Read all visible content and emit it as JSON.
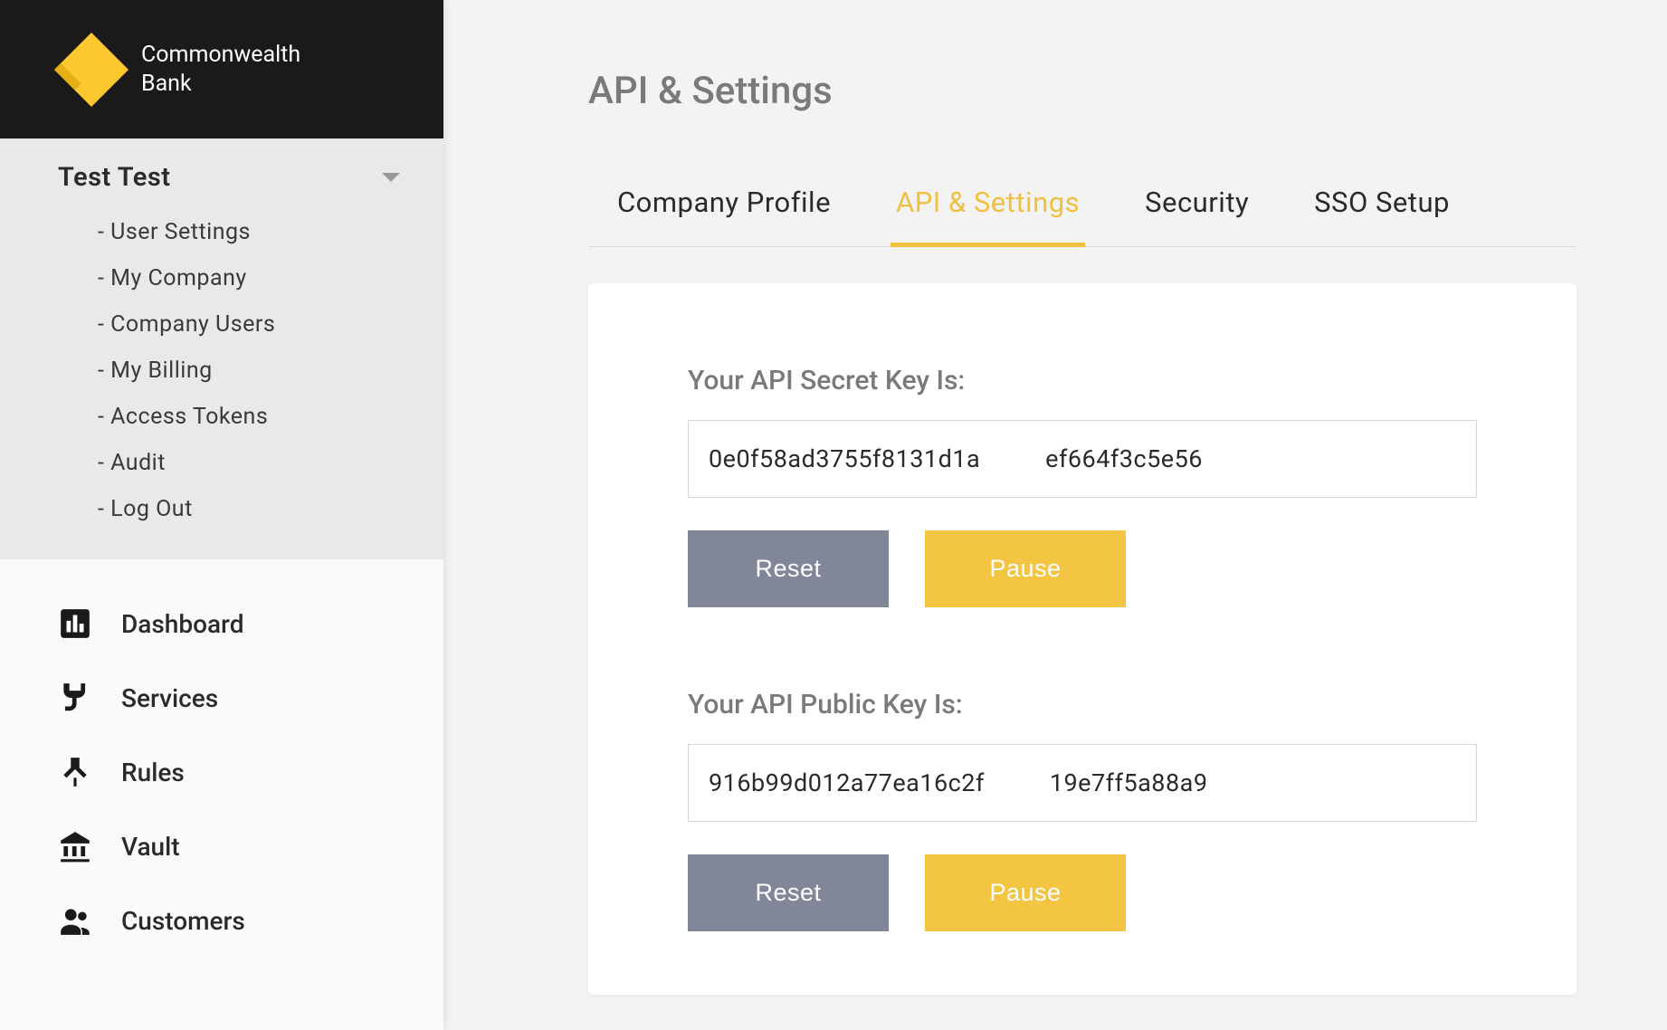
{
  "brand": {
    "line1": "Commonwealth",
    "line2": "Bank"
  },
  "account": {
    "name": "Test Test",
    "subitems": [
      "User Settings",
      "My Company",
      "Company Users",
      "My Billing",
      "Access Tokens",
      "Audit",
      "Log Out"
    ]
  },
  "main_nav": [
    {
      "label": "Dashboard",
      "icon": "bar-chart"
    },
    {
      "label": "Services",
      "icon": "plug"
    },
    {
      "label": "Rules",
      "icon": "branch"
    },
    {
      "label": "Vault",
      "icon": "bank"
    },
    {
      "label": "Customers",
      "icon": "people"
    }
  ],
  "page": {
    "title": "API & Settings"
  },
  "tabs": [
    {
      "label": "Company Profile",
      "active": false
    },
    {
      "label": "API & Settings",
      "active": true
    },
    {
      "label": "Security",
      "active": false
    },
    {
      "label": "SSO Setup",
      "active": false
    }
  ],
  "api": {
    "secret": {
      "label": "Your API Secret Key Is:",
      "value": "0e0f58ad3755f8131d1a          ef664f3c5e56",
      "reset_label": "Reset",
      "pause_label": "Pause"
    },
    "public": {
      "label": "Your API Public Key Is:",
      "value": "916b99d012a77ea16c2f          19e7ff5a88a9",
      "reset_label": "Reset",
      "pause_label": "Pause"
    }
  }
}
